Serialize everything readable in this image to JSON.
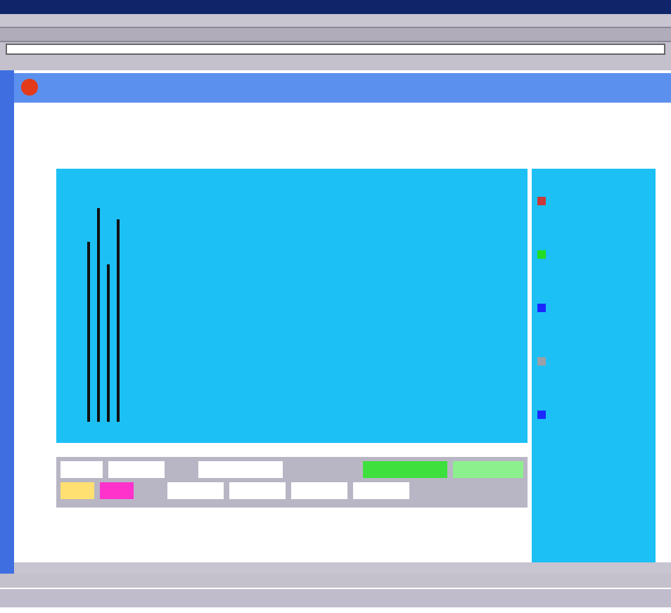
{
  "legend": [
    {
      "color": "#c83a3a"
    },
    {
      "color": "#22dd22"
    },
    {
      "color": "#1a2aff"
    },
    {
      "color": "#9aa0a8"
    },
    {
      "color": "#1a2aff"
    }
  ],
  "swatches": [
    {
      "color": "#ffe070"
    },
    {
      "color": "#ff33cc"
    }
  ],
  "candles": [
    {
      "level": 0.8
    },
    {
      "level": 0.95
    },
    {
      "level": 0.7
    },
    {
      "level": 0.9
    }
  ]
}
